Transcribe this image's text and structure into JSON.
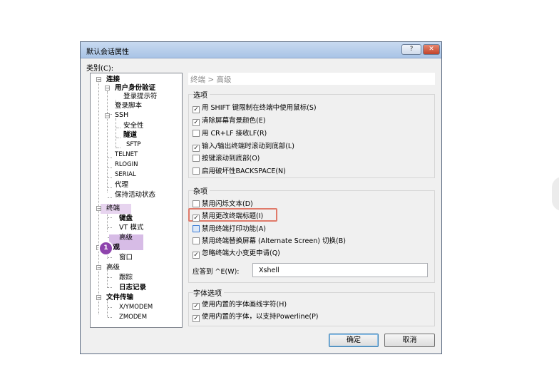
{
  "window": {
    "title": "默认会话属性",
    "help_glyph": "?",
    "close_glyph": "✕"
  },
  "category_label": "类别(C):",
  "tree": {
    "connection": "连接",
    "user_auth": "用户身份验证",
    "login_prompt": "登录提示符",
    "login_script": "登录脚本",
    "ssh": "SSH",
    "security": "安全性",
    "tunnel": "隧道",
    "sftp": "SFTP",
    "telnet": "TELNET",
    "rlogin": "RLOGIN",
    "serial": "SERIAL",
    "proxy": "代理",
    "keepalive": "保持活动状态",
    "terminal": "终端",
    "keyboard": "键盘",
    "vt_mode": "VT 模式",
    "advanced": "高级",
    "appearance": "外观",
    "window": "窗口",
    "adv_top": "高级",
    "trace": "跟踪",
    "log": "日志记录",
    "file_transfer": "文件传输",
    "xymodem": "X/YMODEM",
    "zmodem": "ZMODEM",
    "toggle_expanded": "−"
  },
  "annotation": {
    "badge": "1"
  },
  "panel": {
    "breadcrumb": "终端 > 高级"
  },
  "options": {
    "title": "选项",
    "items": [
      {
        "label": "用 SHIFT 键限制在终端中使用鼠标(S)",
        "checked": "✓"
      },
      {
        "label": "清除屏幕背景颜色(E)",
        "checked": "✓"
      },
      {
        "label": "用 CR+LF 接收LF(R)",
        "checked": ""
      },
      {
        "label": "输入/输出终端时滚动到底部(L)",
        "checked": "✓"
      },
      {
        "label": "按键滚动到底部(O)",
        "checked": ""
      },
      {
        "label": "启用破坏性BACKSPACE(N)",
        "checked": ""
      }
    ]
  },
  "misc": {
    "title": "杂项",
    "items": [
      {
        "label": "禁用闪烁文本(D)",
        "checked": ""
      },
      {
        "label": "禁用更改终端标题(I)",
        "checked": "✓"
      },
      {
        "label": "禁用终端打印功能(A)",
        "checked": ""
      },
      {
        "label": "禁用终端替换屏幕 (Alternate Screen) 切换(B)",
        "checked": ""
      },
      {
        "label": "忽略终端大小变更申请(Q)",
        "checked": "✓"
      }
    ],
    "answer_label": "应答到 ^E(W):",
    "answer_value": "Xshell"
  },
  "font_options": {
    "title": "字体选项",
    "items": [
      {
        "label": "使用内置的字体画线字符(H)",
        "checked": "✓"
      },
      {
        "label": "使用内置的字体，以支持Powerline(P)",
        "checked": "✓"
      }
    ]
  },
  "buttons": {
    "ok": "确定",
    "cancel": "取消"
  },
  "colors": {
    "titlebar": "#b9cfea",
    "highlight": "#d7bce6",
    "badge": "#8e44ad",
    "focus_box": "#e07a6a"
  }
}
